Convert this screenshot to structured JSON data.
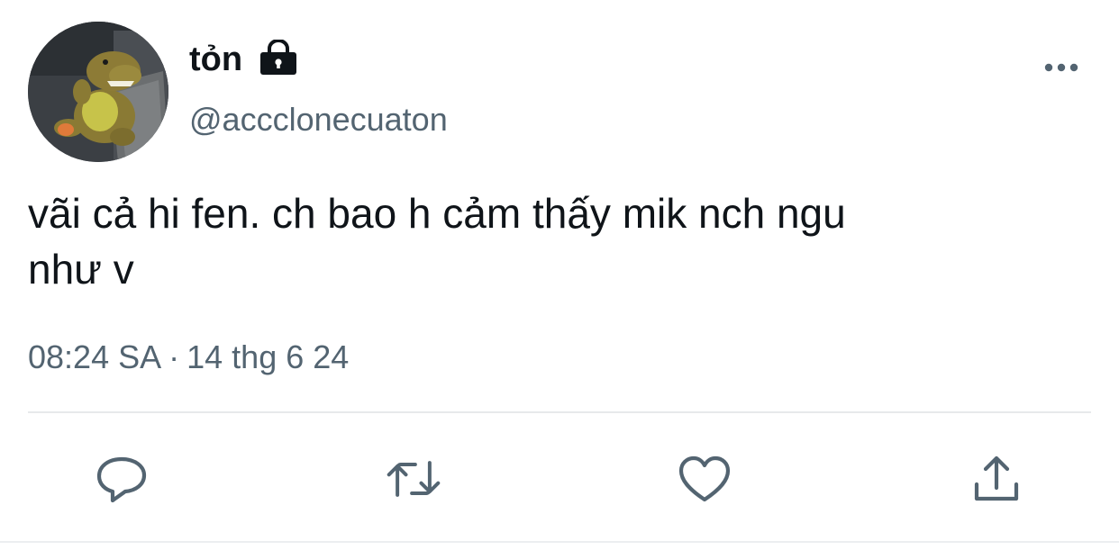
{
  "author": {
    "display_name": "tỏn",
    "handle": "@accclonecuaton",
    "protected_icon": "lock-icon",
    "avatar_icon": "plush-dinosaur-avatar"
  },
  "tweet": {
    "text": "vãi cả hi fen. ch bao h cảm thấy mik nch ngu\nnhư v",
    "time": "08:24 SA",
    "separator": "·",
    "date": "14 thg 6 24"
  },
  "actions": {
    "more_icon": "more-horizontal-icon",
    "reply_icon": "reply-icon",
    "retweet_icon": "retweet-icon",
    "like_icon": "heart-icon",
    "share_icon": "share-icon"
  },
  "colors": {
    "text_primary": "#0f1419",
    "text_secondary": "#536471",
    "icon": "#536471",
    "divider": "#e7e9eb",
    "background": "#ffffff"
  }
}
